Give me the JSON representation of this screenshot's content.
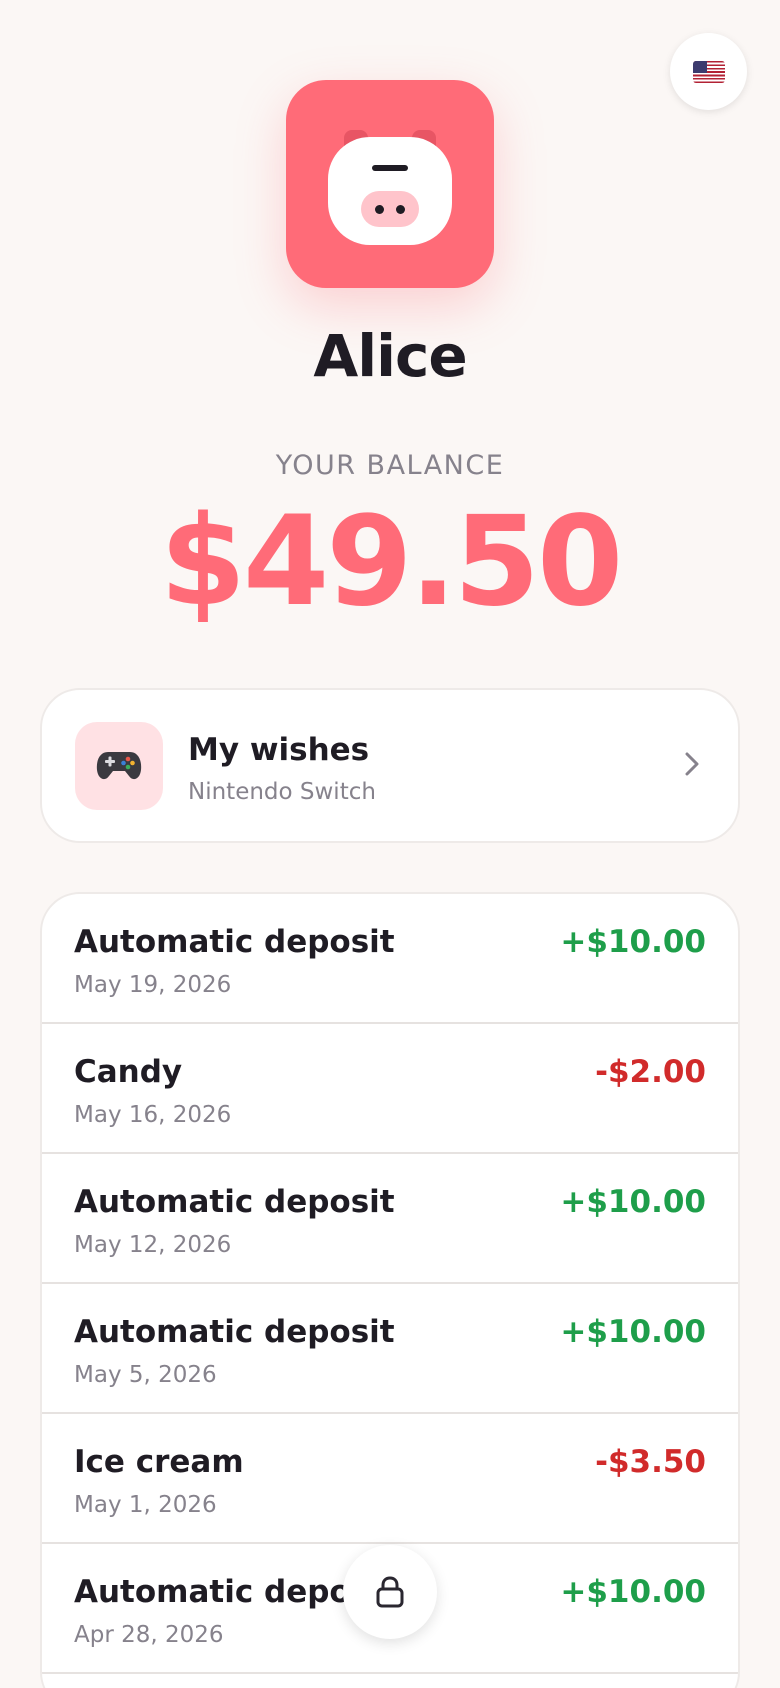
{
  "header": {
    "language_icon": "us-flag-icon",
    "logo_icon": "piggy-bank-icon",
    "name": "Alice"
  },
  "balance": {
    "label": "YOUR BALANCE",
    "amount": "$49.50",
    "color": "#ff6b78"
  },
  "wishes": {
    "icon": "game-controller-icon",
    "title": "My wishes",
    "subtitle": "Nintendo Switch"
  },
  "transactions": [
    {
      "title": "Automatic deposit",
      "date": "May 19, 2026",
      "amount": "+$10.00",
      "type": "credit"
    },
    {
      "title": "Candy",
      "date": "May 16, 2026",
      "amount": "-$2.00",
      "type": "debit"
    },
    {
      "title": "Automatic deposit",
      "date": "May 12, 2026",
      "amount": "+$10.00",
      "type": "credit"
    },
    {
      "title": "Automatic deposit",
      "date": "May 5, 2026",
      "amount": "+$10.00",
      "type": "credit"
    },
    {
      "title": "Ice cream",
      "date": "May 1, 2026",
      "amount": "-$3.50",
      "type": "debit"
    },
    {
      "title": "Automatic deposit",
      "date": "Apr 28, 2026",
      "amount": "+$10.00",
      "type": "credit"
    }
  ],
  "colors": {
    "credit": "#1e9e4a",
    "debit": "#d12b2b",
    "accent": "#ff6b78"
  },
  "lock_icon": "lock-icon"
}
